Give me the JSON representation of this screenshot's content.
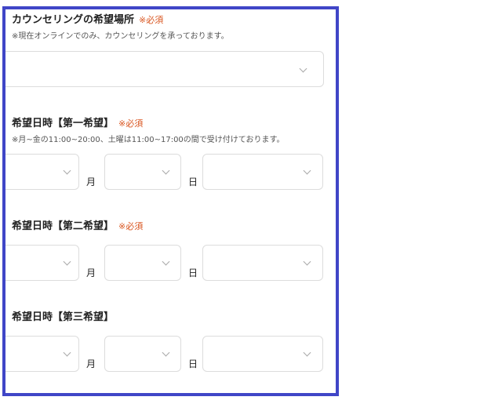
{
  "form": {
    "location": {
      "label": "カウンセリングの希望場所",
      "required": "※必須",
      "note": "※現在オンラインでのみ、カウンセリングを承っております。",
      "selected": ""
    },
    "first_choice": {
      "label": "希望日時【第一希望】",
      "required": "※必須",
      "note": "※月~金の11:00~20:00、土曜は11:00~17:00の間で受け付けております。",
      "month_unit": "月",
      "day_unit": "日"
    },
    "second_choice": {
      "label": "希望日時【第二希望】",
      "required": "※必須",
      "month_unit": "月",
      "day_unit": "日"
    },
    "third_choice": {
      "label": "希望日時【第三希望】",
      "month_unit": "月",
      "day_unit": "日"
    }
  },
  "icons": {
    "dropdown": "chevron-down-icon"
  },
  "colors": {
    "frame_border": "#4046c7",
    "required_text": "#d9541e",
    "field_border": "#dcdcdc",
    "chevron": "#a8a8a8"
  }
}
